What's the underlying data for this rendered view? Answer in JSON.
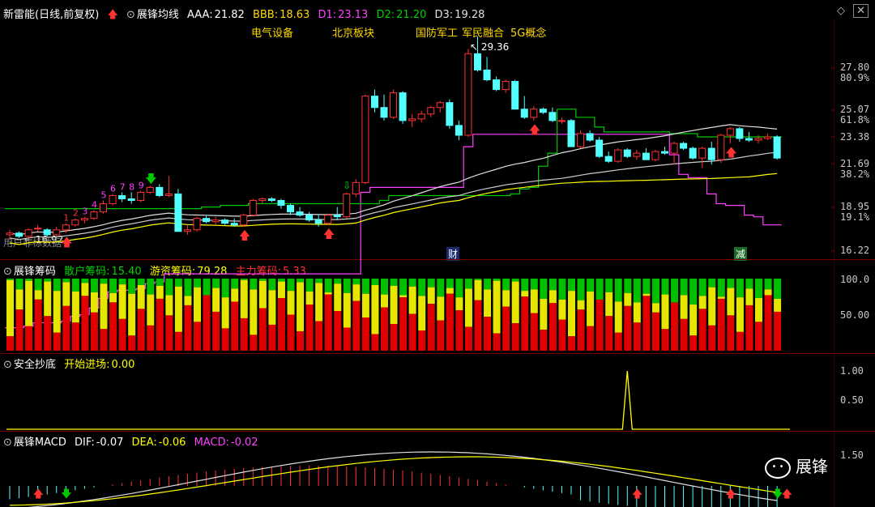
{
  "header": {
    "stock_name": "新雷能",
    "period": "(日线,前复权)",
    "indicator_name": "展锋均线",
    "aaa_label": "AAA:",
    "aaa_value": "21.82",
    "bbb_label": "BBB:",
    "bbb_value": "18.63",
    "d1_label": "D1:",
    "d1_value": "23.13",
    "d2_label": "D2:",
    "d2_value": "21.20",
    "d3_label": "D3:",
    "d3_value": "19.28"
  },
  "sectors": [
    "电气设备",
    "北京板块",
    "国防军工",
    "军民融合",
    "5G概念"
  ],
  "price_axis": {
    "ticks": [
      "27.80",
      "25.07",
      "23.38",
      "21.69",
      "18.95",
      "16.22"
    ],
    "pct": [
      "80.9%",
      "61.8%",
      "38.2%",
      "19.1%"
    ]
  },
  "annotations": {
    "high": "29.36",
    "low": "16.92",
    "low_note": "用户非标数据",
    "cai": "财",
    "jian": "减",
    "counts": [
      "1",
      "2",
      "3",
      "4",
      "5",
      "6",
      "7",
      "8",
      "9"
    ]
  },
  "chip": {
    "title": "展锋筹码",
    "retail_label": "散户筹码:",
    "retail_value": "15.40",
    "hot_label": "游资筹码:",
    "hot_value": "79.28",
    "main_label": "主力筹码:",
    "main_value": "5.33",
    "axis": [
      "100.0",
      "50.00"
    ]
  },
  "safe": {
    "title": "安全抄底",
    "label": "开始进场:",
    "value": "0.00",
    "axis": [
      "1.00",
      "0.50"
    ]
  },
  "macd": {
    "title": "展锋MACD",
    "dif_label": "DIF:",
    "dif_value": "-0.07",
    "dea_label": "DEA:",
    "dea_value": "-0.06",
    "macd_label": "MACD:",
    "macd_value": "-0.02",
    "axis": [
      "1.50"
    ]
  },
  "watermark": "展锋",
  "colors": {
    "up": "#ff3232",
    "down": "#54ffff",
    "magenta": "#ff40ff",
    "green": "#00c800",
    "yellow": "#ffff00",
    "white": "#e0e0e0",
    "red_bar": "#e00000",
    "yellow_bar": "#e6e600",
    "green_bar": "#00c000"
  },
  "chart_data": {
    "type": "candlestick",
    "candles": [
      [
        17.2,
        17.5,
        16.9,
        17.3
      ],
      [
        17.3,
        17.4,
        17.0,
        17.1
      ],
      [
        17.1,
        17.6,
        17.0,
        17.5
      ],
      [
        17.6,
        17.8,
        17.4,
        17.6
      ],
      [
        17.5,
        17.6,
        17.1,
        17.2
      ],
      [
        17.2,
        17.7,
        17.1,
        17.5
      ],
      [
        17.5,
        17.9,
        17.3,
        17.8
      ],
      [
        17.8,
        18.2,
        17.7,
        18.1
      ],
      [
        18.1,
        18.3,
        17.9,
        18.2
      ],
      [
        18.2,
        18.7,
        18.1,
        18.6
      ],
      [
        18.6,
        19.3,
        18.5,
        19.1
      ],
      [
        19.1,
        19.7,
        19.0,
        19.6
      ],
      [
        19.6,
        19.8,
        19.2,
        19.4
      ],
      [
        19.4,
        19.8,
        19.1,
        19.3
      ],
      [
        19.3,
        19.9,
        19.2,
        19.8
      ],
      [
        19.8,
        20.2,
        19.7,
        20.1
      ],
      [
        20.1,
        20.3,
        19.5,
        19.6
      ],
      [
        19.6,
        20.8,
        19.5,
        19.7
      ],
      [
        19.7,
        20.0,
        18.3,
        17.4
      ],
      [
        17.4,
        17.8,
        17.2,
        17.5
      ],
      [
        17.5,
        18.3,
        17.4,
        18.2
      ],
      [
        18.2,
        18.4,
        17.9,
        18.0
      ],
      [
        18.0,
        18.3,
        17.8,
        18.1
      ],
      [
        18.1,
        18.2,
        17.8,
        17.9
      ],
      [
        17.9,
        18.2,
        17.7,
        17.8
      ],
      [
        17.8,
        18.5,
        17.7,
        18.4
      ],
      [
        18.4,
        19.4,
        18.3,
        19.3
      ],
      [
        19.3,
        19.5,
        19.1,
        19.4
      ],
      [
        19.4,
        19.5,
        19.2,
        19.3
      ],
      [
        19.3,
        19.4,
        18.8,
        19.0
      ],
      [
        19.0,
        19.1,
        18.4,
        18.6
      ],
      [
        18.6,
        18.9,
        18.3,
        18.4
      ],
      [
        18.4,
        18.6,
        18.0,
        18.1
      ],
      [
        18.1,
        18.4,
        17.7,
        17.9
      ],
      [
        17.9,
        18.5,
        17.8,
        18.4
      ],
      [
        18.4,
        18.9,
        18.1,
        18.3
      ],
      [
        18.3,
        19.8,
        18.2,
        19.7
      ],
      [
        19.7,
        20.6,
        19.5,
        20.4
      ],
      [
        20.4,
        25.8,
        20.3,
        25.7
      ],
      [
        25.7,
        26.1,
        24.7,
        25.0
      ],
      [
        25.0,
        25.8,
        24.2,
        24.4
      ],
      [
        24.4,
        26.1,
        24.3,
        25.9
      ],
      [
        25.9,
        26.0,
        24.0,
        24.2
      ],
      [
        24.2,
        24.6,
        23.8,
        24.3
      ],
      [
        24.3,
        24.8,
        24.1,
        24.6
      ],
      [
        24.6,
        25.1,
        24.4,
        25.0
      ],
      [
        25.0,
        25.4,
        24.7,
        25.3
      ],
      [
        25.3,
        25.5,
        23.7,
        23.9
      ],
      [
        23.9,
        24.2,
        23.0,
        23.3
      ],
      [
        23.3,
        28.6,
        23.2,
        28.3
      ],
      [
        28.3,
        29.36,
        27.2,
        27.3
      ],
      [
        27.3,
        28.1,
        26.6,
        26.7
      ],
      [
        26.7,
        26.9,
        26.0,
        26.1
      ],
      [
        26.1,
        26.7,
        25.9,
        26.6
      ],
      [
        26.6,
        26.7,
        25.0,
        24.9
      ],
      [
        24.9,
        25.7,
        24.3,
        24.4
      ],
      [
        24.4,
        25.1,
        24.2,
        24.9
      ],
      [
        24.9,
        25.0,
        24.6,
        24.7
      ],
      [
        24.7,
        25.0,
        24.1,
        24.2
      ],
      [
        24.2,
        24.4,
        24.0,
        24.2
      ],
      [
        24.2,
        24.3,
        23.1,
        22.6
      ],
      [
        22.6,
        23.6,
        22.5,
        23.4
      ],
      [
        23.4,
        23.6,
        22.9,
        23.0
      ],
      [
        23.0,
        23.2,
        21.9,
        22.0
      ],
      [
        22.0,
        22.3,
        21.6,
        21.7
      ],
      [
        21.7,
        22.5,
        21.6,
        22.4
      ],
      [
        22.4,
        22.5,
        21.9,
        22.0
      ],
      [
        22.0,
        22.4,
        21.8,
        22.2
      ],
      [
        22.2,
        22.5,
        21.9,
        21.8
      ],
      [
        21.8,
        22.4,
        21.7,
        22.3
      ],
      [
        22.3,
        22.6,
        22.1,
        22.2
      ],
      [
        22.2,
        22.9,
        21.5,
        22.8
      ],
      [
        22.8,
        22.9,
        22.4,
        22.5
      ],
      [
        22.5,
        22.6,
        21.8,
        21.9
      ],
      [
        21.9,
        22.6,
        21.3,
        22.5
      ],
      [
        22.5,
        22.9,
        21.5,
        21.8
      ],
      [
        21.8,
        23.4,
        21.6,
        23.3
      ],
      [
        23.3,
        23.8,
        22.8,
        23.7
      ],
      [
        23.7,
        23.8,
        22.9,
        23.1
      ],
      [
        23.1,
        23.5,
        22.9,
        23.0
      ],
      [
        23.0,
        23.3,
        22.8,
        23.1
      ],
      [
        23.1,
        23.4,
        23.0,
        23.2
      ],
      [
        23.2,
        23.3,
        21.8,
        21.9
      ]
    ],
    "ylim": [
      15.8,
      30.4
    ]
  }
}
